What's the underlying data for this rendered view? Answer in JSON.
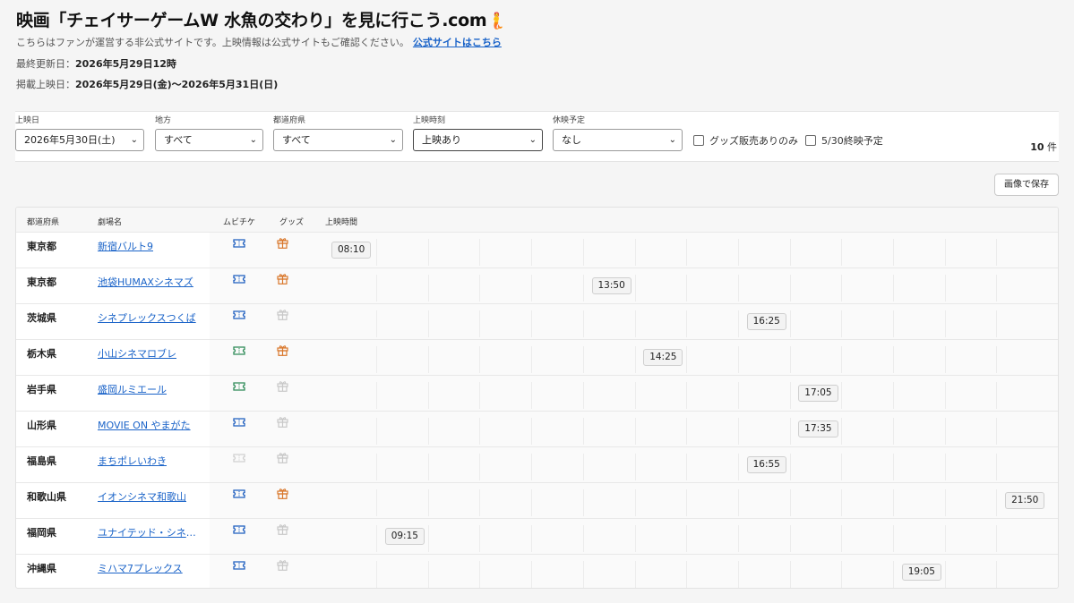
{
  "header": {
    "title": "映画「チェイサーゲームW 水魚の交わり」を見に行こう.com",
    "title_emoji": "🧜",
    "notice": "こちらはファンが運営する非公式サイトです。上映情報は公式サイトもご確認ください。",
    "official_link": "公式サイトはこちら",
    "updated_label": "最終更新日：",
    "updated_value": "2026年5月29日12時",
    "period_label": "掲載上映日：",
    "period_value": "2026年5月29日(金)〜2026年5月31日(日)"
  },
  "filters": {
    "date": {
      "label": "上映日",
      "value": "2026年5月30日(土)"
    },
    "region": {
      "label": "地方",
      "value": "すべて"
    },
    "prefecture": {
      "label": "都道府県",
      "value": "すべて"
    },
    "showtime": {
      "label": "上映時刻",
      "value": "上映あり"
    },
    "closure": {
      "label": "休映予定",
      "value": "なし"
    },
    "goods_only": {
      "label": "グッズ販売ありのみ",
      "checked": false
    },
    "last_day": {
      "label": "5/30終映予定",
      "checked": false
    },
    "count_value": "10",
    "count_unit": "件"
  },
  "save_button": "画像で保存",
  "table": {
    "headers": {
      "prefecture": "都道府県",
      "theater": "劇場名",
      "muvi": "ムビチケ",
      "goods": "グッズ",
      "showtimes": "上映時間"
    },
    "rows": [
      {
        "prefecture": "東京都",
        "theater": "新宿バルト9",
        "muvi": "blue",
        "goods": "on",
        "time": "08:10",
        "slot": 0
      },
      {
        "prefecture": "東京都",
        "theater": "池袋HUMAXシネマズ",
        "muvi": "blue",
        "goods": "on",
        "time": "13:50",
        "slot": 5
      },
      {
        "prefecture": "茨城県",
        "theater": "シネプレックスつくば",
        "muvi": "blue",
        "goods": "off",
        "time": "16:25",
        "slot": 8
      },
      {
        "prefecture": "栃木県",
        "theater": "小山シネマロブレ",
        "muvi": "green",
        "goods": "on",
        "time": "14:25",
        "slot": 6
      },
      {
        "prefecture": "岩手県",
        "theater": "盛岡ルミエール",
        "muvi": "green",
        "goods": "off",
        "time": "17:05",
        "slot": 9
      },
      {
        "prefecture": "山形県",
        "theater": "MOVIE ON やまがた",
        "muvi": "blue",
        "goods": "off",
        "time": "17:35",
        "slot": 9
      },
      {
        "prefecture": "福島県",
        "theater": "まちポレいわき",
        "muvi": "none",
        "goods": "off",
        "time": "16:55",
        "slot": 8
      },
      {
        "prefecture": "和歌山県",
        "theater": "イオンシネマ和歌山",
        "muvi": "blue",
        "goods": "on",
        "time": "21:50",
        "slot": 13
      },
      {
        "prefecture": "福岡県",
        "theater": "ユナイテッド・シネマ…",
        "muvi": "blue",
        "goods": "off",
        "time": "09:15",
        "slot": 1
      },
      {
        "prefecture": "沖縄県",
        "theater": "ミハマ7プレックス",
        "muvi": "blue",
        "goods": "off",
        "time": "19:05",
        "slot": 11
      }
    ]
  },
  "colors": {
    "link": "#1a63c8",
    "muvi_blue": "#1f5fbf",
    "muvi_green": "#2e8b57",
    "muvi_none": "#d0d0d0",
    "goods_on": "#d9772b",
    "goods_off": "#c8c8c8"
  },
  "icons": {
    "muvi": "ticket-icon",
    "goods": "gift-icon",
    "select_arrow": "chevron-down-icon"
  }
}
